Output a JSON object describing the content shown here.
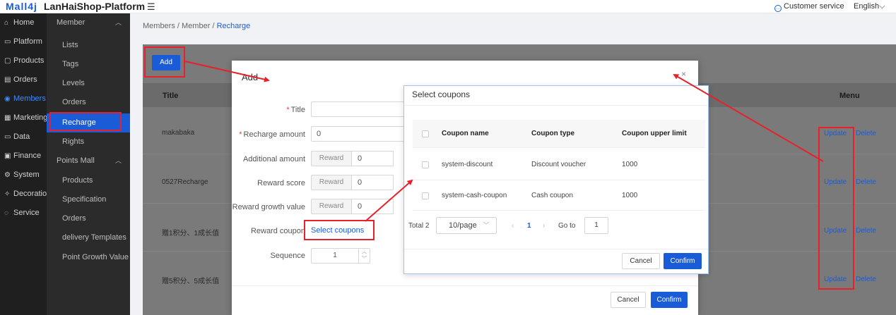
{
  "header": {
    "logo": "Mall4j",
    "platform": "LanHaiShop-Platform",
    "menu_icon": "hamburger-icon",
    "customer_service": "Customer service",
    "language": "English"
  },
  "sidebar_main": [
    {
      "label": "Home",
      "icon": "home-icon"
    },
    {
      "label": "Platform",
      "icon": "platform-icon"
    },
    {
      "label": "Products",
      "icon": "products-icon"
    },
    {
      "label": "Orders",
      "icon": "orders-icon"
    },
    {
      "label": "Members",
      "icon": "members-icon"
    },
    {
      "label": "Marketing",
      "icon": "marketing-icon"
    },
    {
      "label": "Data",
      "icon": "data-icon"
    },
    {
      "label": "Finance",
      "icon": "finance-icon"
    },
    {
      "label": "System",
      "icon": "system-icon"
    },
    {
      "label": "Decoration",
      "icon": "decoration-icon"
    },
    {
      "label": "Service",
      "icon": "service-icon"
    }
  ],
  "sidebar_sub": {
    "member_group": "Member",
    "member_items": [
      "Lists",
      "Tags",
      "Levels",
      "Orders",
      "Recharge",
      "Rights"
    ],
    "points_group": "Points Mall",
    "points_items": [
      "Products",
      "Specification",
      "Orders",
      "delivery Templates",
      "Point Growth Value"
    ]
  },
  "breadcrumb": {
    "a": "Members",
    "b": "Member",
    "c": "Recharge",
    "sep": "/"
  },
  "page": {
    "add_label": "Add",
    "col_title": "Title",
    "col_menu": "Menu",
    "rows": [
      {
        "title": "makabaka"
      },
      {
        "title": "0527Recharge"
      },
      {
        "title": "赠1积分、1成长值"
      },
      {
        "title": "赠5积分、5成长值"
      }
    ],
    "update_label": "Update",
    "delete_label": "Delete"
  },
  "add_dialog": {
    "title": "Add",
    "close": "×",
    "required_mark": "*",
    "title_label": "Title",
    "title_value": "",
    "recharge_label": "Recharge amount",
    "recharge_value": "0",
    "additional_label": "Additional amount",
    "reward_score_label": "Reward score",
    "reward_growth_label": "Reward growth value",
    "reward_tag": "Reward",
    "additional_value": "0",
    "score_value": "0",
    "growth_value": "0",
    "reward_coupon_label": "Reward coupon",
    "select_coupons": "Select coupons",
    "sequence_label": "Sequence",
    "sequence_value": "1",
    "cancel": "Cancel",
    "confirm": "Confirm"
  },
  "coupons_dialog": {
    "title": "Select coupons",
    "columns": [
      "Coupon name",
      "Coupon type",
      "Coupon upper limit"
    ],
    "rows": [
      {
        "name": "system-discount",
        "type": "Discount voucher",
        "limit": "1000"
      },
      {
        "name": "system-cash-coupon",
        "type": "Cash coupon",
        "limit": "1000"
      }
    ],
    "total": "Total 2",
    "page_size": "10/page",
    "current_page": "1",
    "goto_label": "Go to",
    "goto_value": "1",
    "cancel": "Cancel",
    "confirm": "Confirm"
  },
  "colors": {
    "accent": "#1a5cd7",
    "annotation": "#e8202a",
    "sidebar": "#1f1f1f"
  }
}
